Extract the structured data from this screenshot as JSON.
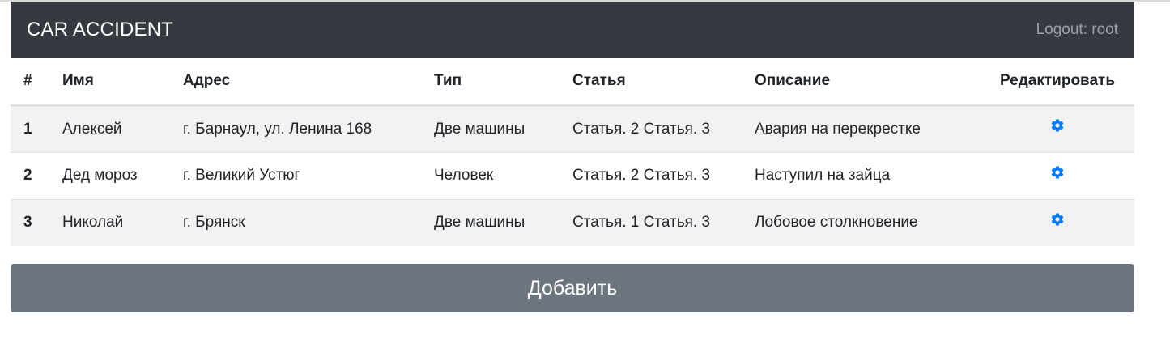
{
  "navbar": {
    "brand": "CAR ACCIDENT",
    "logout_label": "Logout: root"
  },
  "table": {
    "headers": [
      "#",
      "Имя",
      "Адрес",
      "Тип",
      "Статья",
      "Описание",
      "Редактировать"
    ],
    "rows": [
      {
        "num": "1",
        "name": "Алексей",
        "address": "г. Барнаул, ул. Ленина 168",
        "type": "Две машины",
        "articles": "Статья. 2 Статья. 3",
        "description": "Авария на перекрестке",
        "edit_icon": "gear-icon"
      },
      {
        "num": "2",
        "name": "Дед мороз",
        "address": "г. Великий Устюг",
        "type": "Человек",
        "articles": "Статья. 2 Статья. 3",
        "description": "Наступил на зайца",
        "edit_icon": "gear-icon"
      },
      {
        "num": "3",
        "name": "Николай",
        "address": "г. Брянск",
        "type": "Две машины",
        "articles": "Статья. 1 Статья. 3",
        "description": "Лобовое столкновение",
        "edit_icon": "gear-icon"
      }
    ]
  },
  "add_button_label": "Добавить",
  "colors": {
    "navbar_bg": "#343a40",
    "icon_blue": "#007bff",
    "button_bg": "#6c757d"
  }
}
